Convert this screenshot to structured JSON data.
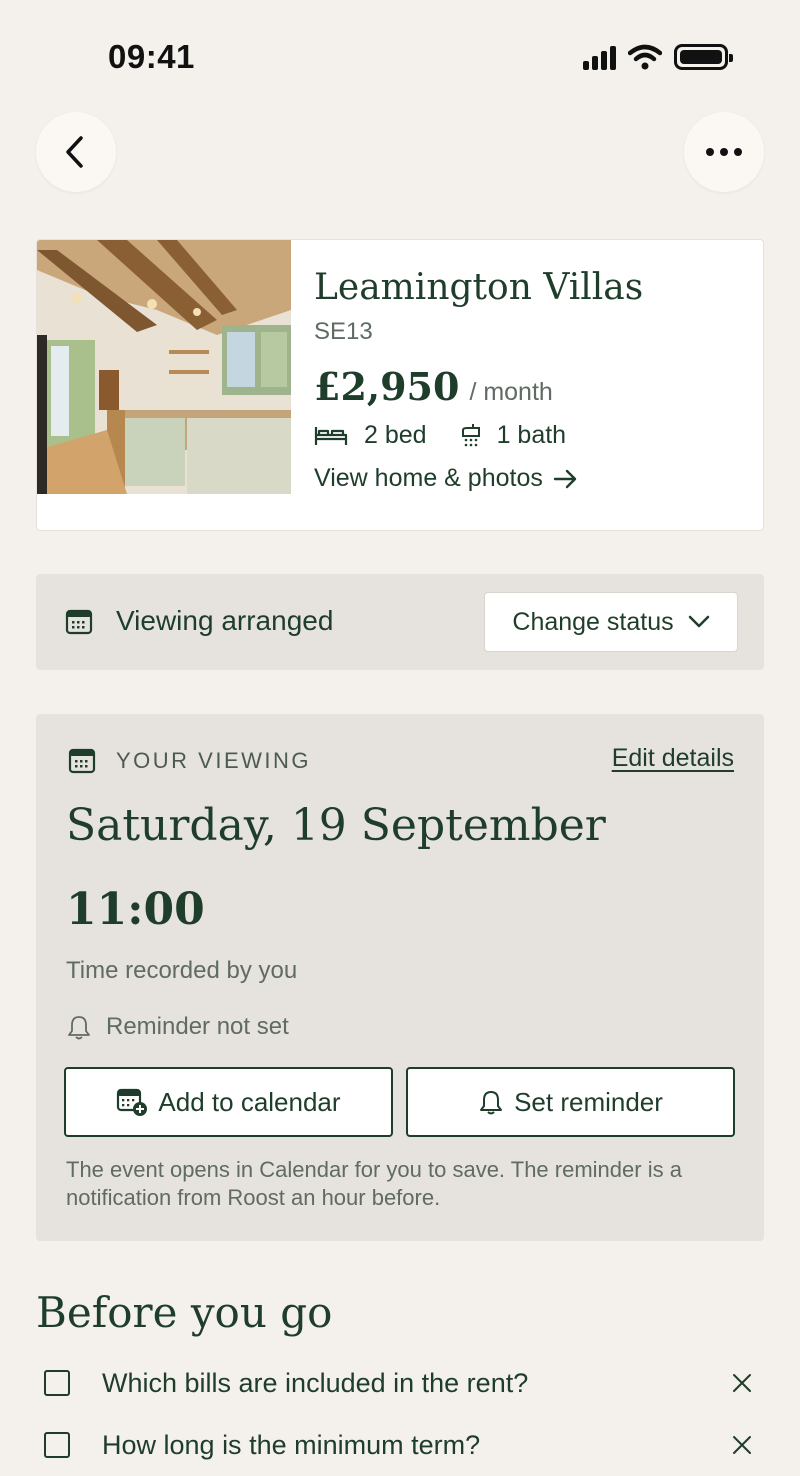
{
  "status_bar": {
    "time": "09:41"
  },
  "nav": {
    "back_icon": "chevron-left-icon",
    "more_icon": "ellipsis-icon"
  },
  "listing": {
    "name": "Leamington Villas",
    "area": "SE13",
    "price": "£2,950",
    "price_period": "/ month",
    "beds": "2 bed",
    "baths": "1 bath",
    "view_link": "View home & photos",
    "photo_icon": "kitchen-photo"
  },
  "status": {
    "text": "Viewing arranged",
    "change_label": "Change status"
  },
  "viewing": {
    "section_label": "YOUR VIEWING",
    "edit_label": "Edit details",
    "date": "Saturday, 19 September",
    "time": "11:00",
    "time_note": "Time recorded by you",
    "reminder_status": "Reminder not set",
    "add_calendar_label": "Add to calendar",
    "set_reminder_label": "Set reminder",
    "footnote": "The event opens in Calendar for you to save. The reminder is a notification from Roost an hour before."
  },
  "before_you_go": {
    "title": "Before you go",
    "items": [
      {
        "text": "Which bills are included in the rent?",
        "checked": false
      },
      {
        "text": "How long is the minimum term?",
        "checked": false
      }
    ]
  },
  "colors": {
    "background": "#f4f0eb",
    "panel": "#e6e3de",
    "accent": "#1f3d2b"
  }
}
